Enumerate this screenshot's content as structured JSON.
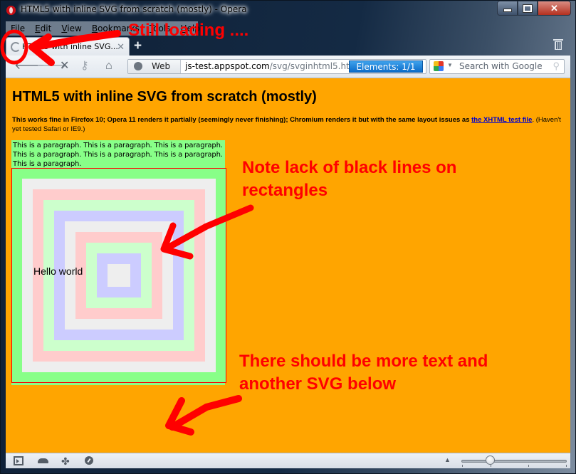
{
  "window": {
    "title": "HTML5 with inline SVG from scratch (mostly) - Opera",
    "controls": {
      "minimize": "minimize",
      "maximize": "maximize",
      "close": "✕"
    }
  },
  "menu": {
    "items": [
      {
        "label": "File",
        "accesskey": "F",
        "rest": "ile"
      },
      {
        "label": "Edit",
        "accesskey": "E",
        "rest": "dit"
      },
      {
        "label": "View",
        "accesskey": "V",
        "rest": "iew"
      },
      {
        "label": "Bookmarks",
        "accesskey": "B",
        "rest": "ookmarks"
      },
      {
        "label": "Tools",
        "accesskey": "T",
        "rest": "ools"
      },
      {
        "label": "Help",
        "accesskey": "H",
        "rest": "elp"
      }
    ]
  },
  "tabs": [
    {
      "label": "HTML5 with inline SVG...",
      "loading": true,
      "active": true
    }
  ],
  "toolbar": {
    "back": "back",
    "forward": "forward",
    "stop": "stop",
    "wand": "key",
    "home": "home",
    "address": {
      "badge": "Web",
      "host": "js-test.appspot.com",
      "path": "/svg/svginhtml5.html",
      "elements_label": "Elements:  1/1"
    },
    "search": {
      "engine": "Google",
      "placeholder": "Search with Google"
    }
  },
  "page": {
    "heading": "HTML5 with inline SVG from scratch (mostly)",
    "intro": {
      "text": "This works fine in Firefox 10; Opera 11 renders it partially (seemingly never finishing); Chromium renders it but with the same layout issues as ",
      "link_text": "the XHTML test file",
      "after": ". (Haven't yet tested Safari or IE9.)"
    },
    "paragraph": "This is a paragraph. This is a paragraph. This is a paragraph. This is a paragraph. This is a paragraph. This is a paragraph. This is a paragraph.",
    "svg": {
      "text": "Hello world",
      "border_color": "#ff0000",
      "rect_colors": [
        "#88ff88",
        "#eeeeee",
        "#ffcccc",
        "#ccffcc",
        "#ccccff",
        "#eeeeee",
        "#ffcccc",
        "#ccffcc",
        "#ccccff",
        "#eeeeee"
      ]
    },
    "background": "#ffa500"
  },
  "annotations": {
    "loading": "Still loading ....",
    "lines_line1": "Note lack of black lines on",
    "lines_line2": "rectangles",
    "more_line1": "There should be more text and",
    "more_line2": "another SVG below",
    "color": "#ff0000"
  },
  "statusbar": {
    "panel": "panel-toggle",
    "unite": "unite",
    "turbo": "turbo",
    "speed": "speed-dial",
    "zoom_fraction": 0.27
  }
}
